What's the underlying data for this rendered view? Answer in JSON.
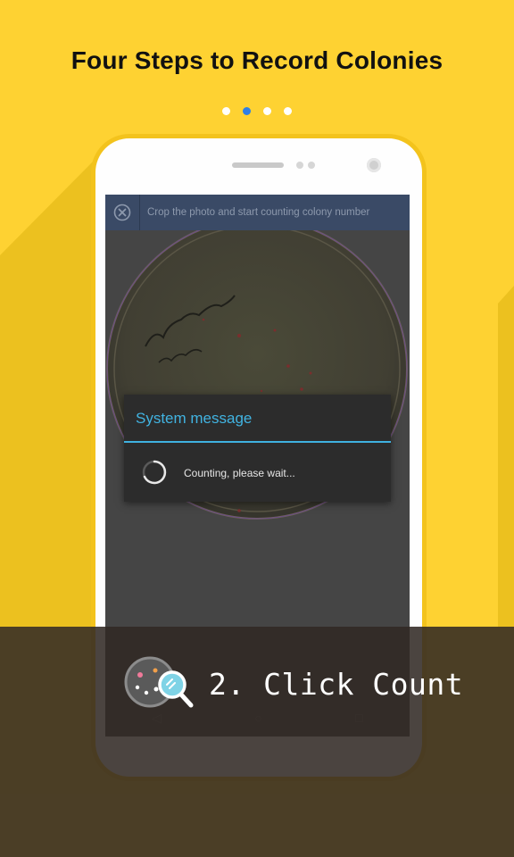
{
  "headline": "Four Steps to Record Colonies",
  "pager": {
    "count": 4,
    "active_index": 1
  },
  "app_bar": {
    "close_icon": "close-circle-icon",
    "hint": "Crop the photo and start counting colony number"
  },
  "dialog": {
    "title": "System message",
    "message": "Counting, please wait..."
  },
  "navbar": {
    "back": "◁",
    "home": "○",
    "recents": "□"
  },
  "step": {
    "label": "2. Click Count",
    "icon": "count-magnifier-icon"
  },
  "colors": {
    "background": "#fed232",
    "accent_blue": "#41b3e1",
    "active_dot": "#2f7fe5",
    "app_bar": "#3a4a66"
  }
}
